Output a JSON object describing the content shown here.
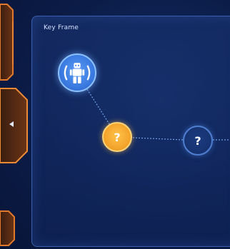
{
  "panel": {
    "title": "Key Frame"
  },
  "graph": {
    "nodes": [
      {
        "id": "robot",
        "icon": "robot-icon",
        "state": "selected"
      },
      {
        "id": "unknown-1",
        "symbol": "?",
        "state": "active"
      },
      {
        "id": "unknown-2",
        "symbol": "?",
        "state": "locked"
      }
    ]
  },
  "rail": {
    "toggle_icon": "chevron-left-icon"
  },
  "colors": {
    "background": "#0b1c48",
    "panel_border": "#3a5fae",
    "rail_accent": "#e07a2a",
    "active_node": "#f3a32a",
    "robot_node": "#3b7ae0",
    "connector": "#7fb3ff"
  }
}
